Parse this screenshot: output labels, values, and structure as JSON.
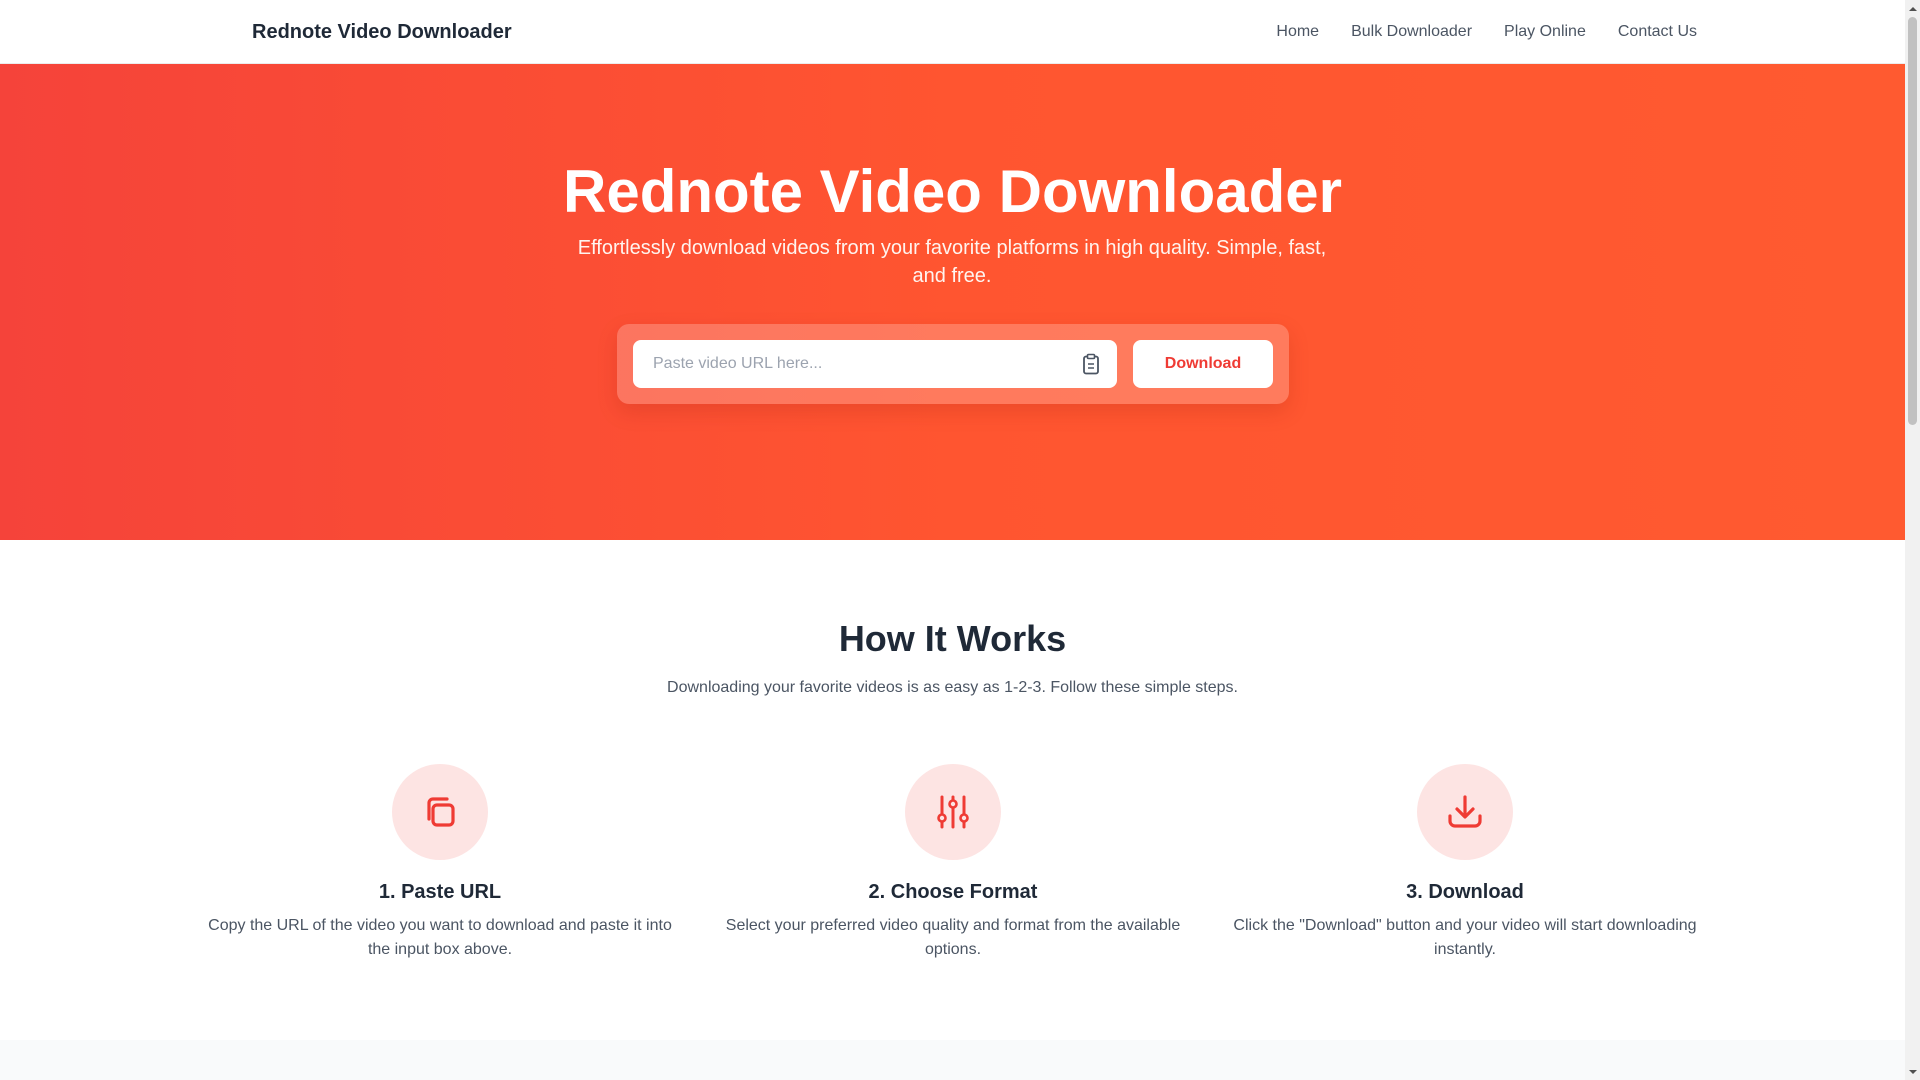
{
  "header": {
    "brand": "Rednote Video Downloader",
    "nav": [
      {
        "label": "Home"
      },
      {
        "label": "Bulk Downloader"
      },
      {
        "label": "Play Online"
      },
      {
        "label": "Contact Us"
      }
    ]
  },
  "hero": {
    "title": "Rednote Video Downloader",
    "subtitle": "Effortlessly download videos from your favorite platforms in high quality. Simple, fast, and free.",
    "input_placeholder": "Paste video URL here...",
    "input_value": "",
    "paste_icon": "clipboard-icon",
    "download_label": "Download"
  },
  "how": {
    "title": "How It Works",
    "subtitle": "Downloading your favorite videos is as easy as 1-2-3. Follow these simple steps.",
    "steps": [
      {
        "icon": "copy-icon",
        "title": "1. Paste URL",
        "desc": "Copy the URL of the video you want to download and paste it into the input box above."
      },
      {
        "icon": "sliders-icon",
        "title": "2. Choose Format",
        "desc": "Select your preferred video quality and format from the available options."
      },
      {
        "icon": "download-icon",
        "title": "3. Download",
        "desc": "Click the \"Download\" button and your video will start downloading instantly."
      }
    ]
  },
  "colors": {
    "accent": "#ef3b34",
    "hero_gradient_start": "#f5433a",
    "hero_gradient_end": "#ff5a30",
    "icon_circle": "#fde4e3"
  }
}
